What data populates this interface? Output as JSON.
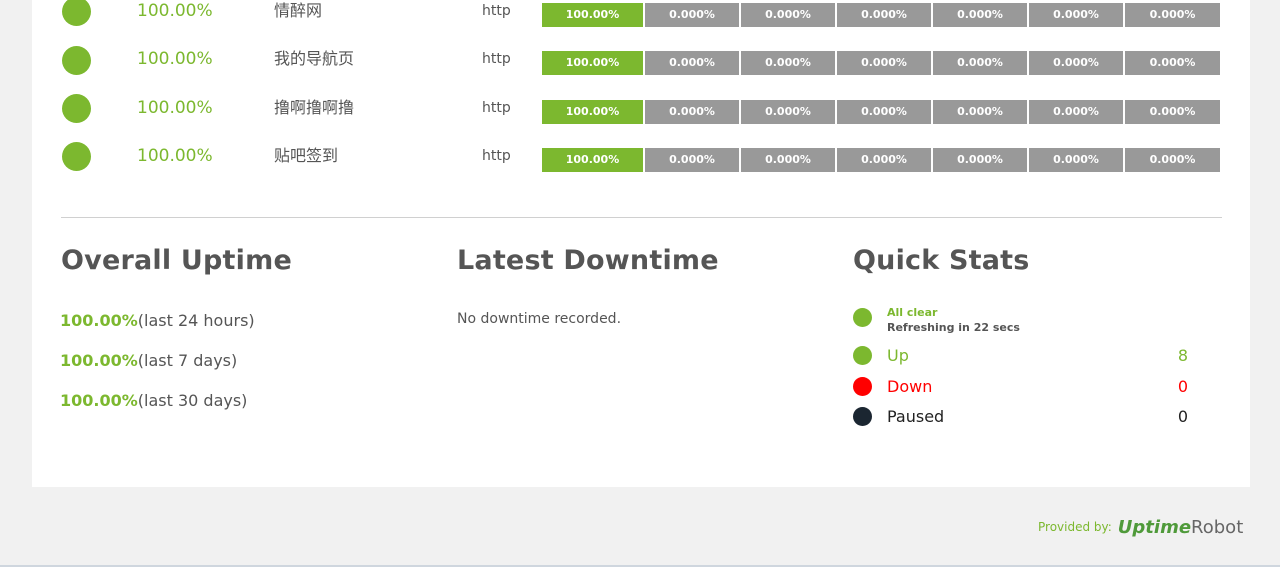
{
  "monitors": [
    {
      "uptime": "100.00%",
      "name": "情醉网",
      "type": "http",
      "bars": [
        "100.00%",
        "0.000%",
        "0.000%",
        "0.000%",
        "0.000%",
        "0.000%",
        "0.000%"
      ]
    },
    {
      "uptime": "100.00%",
      "name": "我的导航页",
      "type": "http",
      "bars": [
        "100.00%",
        "0.000%",
        "0.000%",
        "0.000%",
        "0.000%",
        "0.000%",
        "0.000%"
      ]
    },
    {
      "uptime": "100.00%",
      "name": "撸啊撸啊撸",
      "type": "http",
      "bars": [
        "100.00%",
        "0.000%",
        "0.000%",
        "0.000%",
        "0.000%",
        "0.000%",
        "0.000%"
      ]
    },
    {
      "uptime": "100.00%",
      "name": "贴吧签到",
      "type": "http",
      "bars": [
        "100.00%",
        "0.000%",
        "0.000%",
        "0.000%",
        "0.000%",
        "0.000%",
        "0.000%"
      ]
    }
  ],
  "overall_uptime": {
    "title": "Overall Uptime",
    "items": [
      {
        "pct": "100.00%",
        "period": "(last 24 hours)"
      },
      {
        "pct": "100.00%",
        "period": "(last 7 days)"
      },
      {
        "pct": "100.00%",
        "period": "(last 30 days)"
      }
    ]
  },
  "latest_downtime": {
    "title": "Latest Downtime",
    "text": "No downtime recorded."
  },
  "quick_stats": {
    "title": "Quick Stats",
    "all_clear": "All clear",
    "refreshing": "Refreshing in 22 secs",
    "items": [
      {
        "label": "Up",
        "count": "8",
        "color": "#7cb82f"
      },
      {
        "label": "Down",
        "count": "0",
        "color": "#ff0000"
      },
      {
        "label": "Paused",
        "count": "0",
        "color": "#1b2631"
      }
    ]
  },
  "footer": {
    "provided_by": "Provided by:",
    "logo_uptime": "Uptime",
    "logo_robot": "Robot"
  },
  "colors": {
    "accent": "#7cb82f",
    "bar_grey": "#999999",
    "down": "#ff0000",
    "paused": "#1b2631"
  }
}
